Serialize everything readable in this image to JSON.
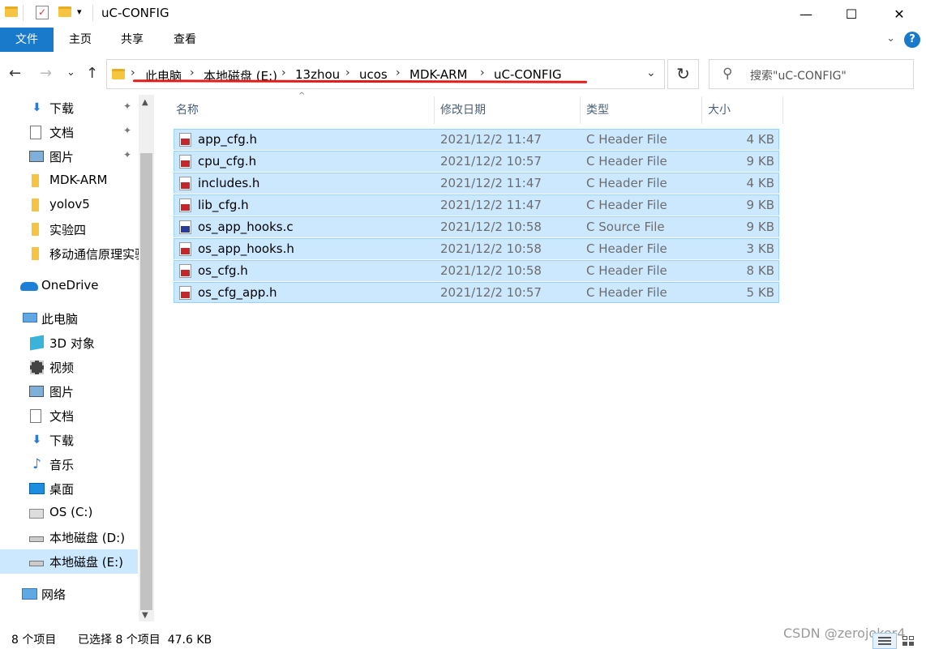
{
  "window": {
    "title": "uC-CONFIG",
    "quick_access_caret": "▾",
    "minimize": "—",
    "maximize": "☐",
    "close": "✕"
  },
  "ribbon": {
    "tabs": [
      "文件",
      "主页",
      "共享",
      "查看"
    ],
    "caret": "⌄",
    "help": "?"
  },
  "nav": {
    "back": "←",
    "forward": "→",
    "recent": "⌄",
    "up": "↑",
    "breadcrumb": [
      "此电脑",
      "本地磁盘 (E:)",
      "13zhou",
      "ucos",
      "MDK-ARM",
      "uC-CONFIG"
    ],
    "separator": "›",
    "dropdown": "⌄",
    "refresh": "↻",
    "search_placeholder": "搜索\"uC-CONFIG\""
  },
  "sidebar": {
    "items": [
      {
        "label": "下载",
        "icon": "download-icon",
        "pinned": true
      },
      {
        "label": "文档",
        "icon": "document-icon",
        "pinned": true
      },
      {
        "label": "图片",
        "icon": "pictures-icon",
        "pinned": true
      },
      {
        "label": "MDK-ARM",
        "icon": "folder-icon"
      },
      {
        "label": "yolov5",
        "icon": "folder-icon"
      },
      {
        "label": "实验四",
        "icon": "folder-icon"
      },
      {
        "label": "移动通信原理实验",
        "icon": "folder-icon"
      },
      {
        "label": "OneDrive",
        "icon": "onedrive-icon"
      },
      {
        "label": "此电脑",
        "icon": "computer-icon"
      },
      {
        "label": "3D 对象",
        "icon": "3d-objects-icon"
      },
      {
        "label": "视频",
        "icon": "video-icon"
      },
      {
        "label": "图片",
        "icon": "pictures-icon"
      },
      {
        "label": "文档",
        "icon": "document-icon"
      },
      {
        "label": "下载",
        "icon": "download-icon"
      },
      {
        "label": "音乐",
        "icon": "music-icon"
      },
      {
        "label": "桌面",
        "icon": "desktop-icon"
      },
      {
        "label": "OS (C:)",
        "icon": "windows-drive-icon"
      },
      {
        "label": "本地磁盘 (D:)",
        "icon": "drive-icon"
      },
      {
        "label": "本地磁盘 (E:)",
        "icon": "drive-icon",
        "selected": true
      },
      {
        "label": "网络",
        "icon": "network-icon"
      }
    ],
    "pin_glyph": "📌",
    "scroll_up": "▲",
    "scroll_down": "▼"
  },
  "files": {
    "columns": {
      "name": "名称",
      "modified": "修改日期",
      "type": "类型",
      "size": "大小"
    },
    "sort_caret": "^",
    "rows": [
      {
        "name": "app_cfg.h",
        "modified": "2021/12/2 11:47",
        "type": "C Header File",
        "size": "4 KB"
      },
      {
        "name": "cpu_cfg.h",
        "modified": "2021/12/2 10:57",
        "type": "C Header File",
        "size": "9 KB"
      },
      {
        "name": "includes.h",
        "modified": "2021/12/2 11:47",
        "type": "C Header File",
        "size": "4 KB"
      },
      {
        "name": "lib_cfg.h",
        "modified": "2021/12/2 11:47",
        "type": "C Header File",
        "size": "9 KB"
      },
      {
        "name": "os_app_hooks.c",
        "modified": "2021/12/2 10:58",
        "type": "C Source File",
        "size": "9 KB"
      },
      {
        "name": "os_app_hooks.h",
        "modified": "2021/12/2 10:58",
        "type": "C Header File",
        "size": "3 KB"
      },
      {
        "name": "os_cfg.h",
        "modified": "2021/12/2 10:58",
        "type": "C Header File",
        "size": "8 KB"
      },
      {
        "name": "os_cfg_app.h",
        "modified": "2021/12/2 10:57",
        "type": "C Header File",
        "size": "5 KB"
      }
    ]
  },
  "status": {
    "count": "8 个项目",
    "selected": "已选择 8 个项目  47.6 KB",
    "watermark": "CSDN @zerojoker4"
  },
  "colors": {
    "accent": "#1979ca",
    "selection": "#cce8ff",
    "annotation_underline": "#e21b1b"
  }
}
